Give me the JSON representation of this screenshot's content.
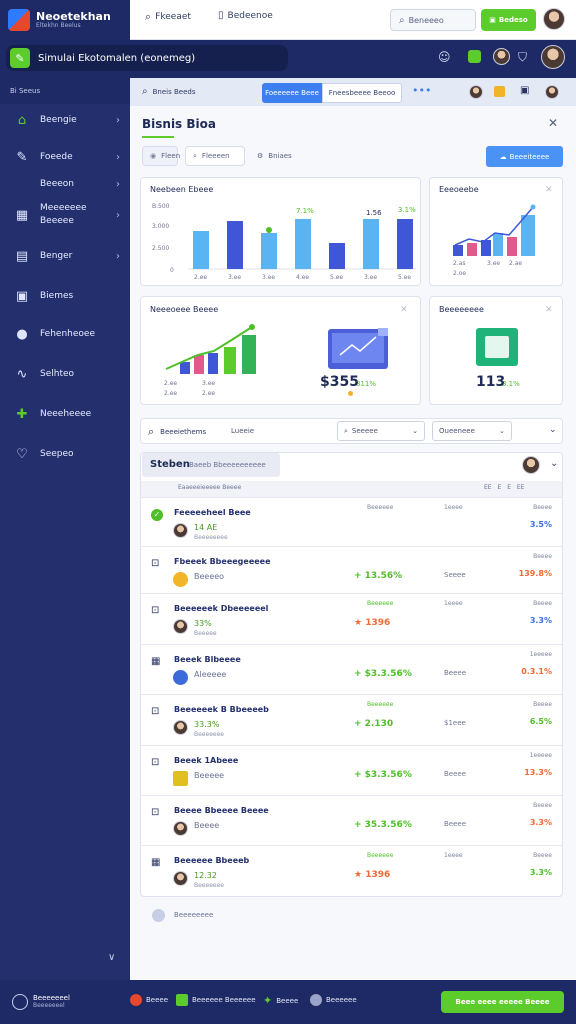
{
  "brand": {
    "title": "Neoetekhan",
    "subtitle": "Eltekhn Beelus"
  },
  "topnav": {
    "item1": "Fkeeaet",
    "item2": "Bedeenoe"
  },
  "search": {
    "placeholder": "Beneeeo"
  },
  "top_button": "Bedeso",
  "sim": {
    "label": "Simulai Ekotomalen (eonemeg)"
  },
  "sidebar": {
    "header": "Bi Seeus",
    "items": [
      {
        "label": "Beengie",
        "icon": "home-icon",
        "chevron": true
      },
      {
        "label": "Foeede",
        "icon": "pen-icon",
        "chevron": true
      },
      {
        "label": "Beeeon",
        "icon": "",
        "chevron": true
      },
      {
        "label": "Meeeeeee Beeeee",
        "icon": "grid-icon",
        "chevron": true
      },
      {
        "label": "Benger",
        "icon": "calendar-icon",
        "chevron": true
      },
      {
        "label": "Biemes",
        "icon": "briefcase-icon",
        "chevron": false
      },
      {
        "label": "Fehenheoee",
        "icon": "chat-icon",
        "chevron": false
      },
      {
        "label": "Selhteo",
        "icon": "pulse-icon",
        "chevron": false
      },
      {
        "label": "Neeeheeee",
        "icon": "puzzle-icon",
        "chevron": false
      },
      {
        "label": "Seepeo",
        "icon": "heart-icon",
        "chevron": false
      }
    ]
  },
  "filterbar": {
    "search": "Bneis Beeds",
    "tab_active": "Foeeeeee Beee",
    "tab_inactive": "Fneesbeeee Beeoo"
  },
  "panel": {
    "title": "Bisnis Bioa",
    "chips": [
      "Fleen",
      "Fleeeen",
      "Bniaes"
    ],
    "action": "Beeeiteeee"
  },
  "cards": {
    "card1": {
      "title": "Neebeen Ebeee",
      "yticks": [
        "B.500",
        "3.000",
        "2.500",
        "0"
      ],
      "xticks": [
        "2.ee",
        "3.ee",
        "3.ee",
        "4.ee",
        "5.ee",
        "3.ee",
        "5.ee"
      ],
      "annotations": [
        "7.1%",
        "1.56",
        "3.1%"
      ]
    },
    "card2": {
      "title": "Eeeoeebe",
      "xticks": [
        "2.as",
        "3.ee",
        "2.ae",
        "2.oe"
      ]
    },
    "card3": {
      "title": "Neeeoeee Beeee",
      "stat": "$355",
      "pct": "311%",
      "xticks": [
        "2.ee",
        "3.ee",
        "2.ee"
      ]
    },
    "card4": {
      "title": "Beeeeeeee",
      "stat": "113",
      "pct": "3.1%"
    }
  },
  "list_filter": {
    "label": "Beeeiethems",
    "input": "Lueeie",
    "select1": "Seeeee",
    "select2": "Oueeneee"
  },
  "list": {
    "section_title": "Steben",
    "section_sub": "Baeeb Bbeeeeeeeeee",
    "head": "Eaaeeeieeeee Beeee",
    "head_right": "EE  E  E  EE",
    "rows": [
      {
        "title": "Feeeeeheel Beee",
        "sub": "14 AE",
        "sub2": "Beeeeeeee",
        "c1": "",
        "c1top": "Beeeeee",
        "c2": "",
        "c2top": "1eeee",
        "c3": "3.5%",
        "c3top": "Beeee",
        "c1color": "#4fbf27",
        "c3color": "#3b6ee0",
        "avatar": "#d7a26b"
      },
      {
        "title": "Fbeeek Bbeeegeeeee",
        "sub": "Beeeeo",
        "sub2": "",
        "c1": "+ 13.56%",
        "c1top": "",
        "c2": "Seeee",
        "c2top": "",
        "c3": "139.8%",
        "c3top": "Beeee",
        "c1color": "#4fbf27",
        "c3color": "#ef6a35",
        "avatar": "#f2b52a"
      },
      {
        "title": "Beeeeeek Dbeeeeeel",
        "sub": "33%",
        "sub2": "Beeeee",
        "c1": "★ 1396",
        "c1top": "Beeeeee",
        "c2": "",
        "c2top": "1eeee",
        "c3": "3.3%",
        "c3top": "Beeee",
        "c1color": "#ef6a35",
        "c3color": "#3b6ee0",
        "avatar": "#c98e63"
      },
      {
        "title": "Beeek Blbeeee",
        "sub": "Aleeeee",
        "sub2": "",
        "c1": "+ $3.3.56%",
        "c1top": "",
        "c2": "Beeee",
        "c2top": "",
        "c3": "0.3.1%",
        "c3top": "1eeeee",
        "c1color": "#4fbf27",
        "c3color": "#ef6a35",
        "avatar": "#3c6ad8"
      },
      {
        "title": "Beeeeeek B Bbeeeeb",
        "sub": "33.3%",
        "sub2": "Beeeeeee",
        "c1": "+ 2.130",
        "c1top": "Beeeeee",
        "c2": "$1eee",
        "c2top": "",
        "c3": "6.5%",
        "c3top": "Beeee",
        "c1color": "#4fbf27",
        "c3color": "#4fbf27",
        "avatar": "#c98e63"
      },
      {
        "title": "Beeek 1Abeee",
        "sub": "Beeeee",
        "sub2": "",
        "c1": "+ $3.3.56%",
        "c1top": "",
        "c2": "Beeee",
        "c2top": "",
        "c3": "13.3%",
        "c3top": "1eeeee",
        "c1color": "#4fbf27",
        "c3color": "#ef6a35",
        "avatar": "#e0c020"
      },
      {
        "title": "Beeee Bbeeee Beeee",
        "sub": "Beeee",
        "sub2": "",
        "c1": "+ 35.3.56%",
        "c1top": "",
        "c2": "Beeee",
        "c2top": "",
        "c3": "3.3%",
        "c3top": "Beeee",
        "c1color": "#4fbf27",
        "c3color": "#ef6a35",
        "avatar": "#c98e63"
      },
      {
        "title": "Beeeeee Bbeeeb",
        "sub": "12.32",
        "sub2": "Beeeeeee",
        "c1": "★ 1396",
        "c1top": "Beeeeee",
        "c2": "",
        "c2top": "1eeee",
        "c3": "3.3%",
        "c3top": "Beeee",
        "c1color": "#ef6a35",
        "c3color": "#4fbf27",
        "avatar": "#c98e63"
      }
    ],
    "footer_label": "Beeeeeeee"
  },
  "footer": {
    "brand_title": "Beeeeeeel",
    "brand_sub": "Beeeeeeel",
    "items": [
      "Beeee",
      "Beeeeee Beeeeee",
      "Beeee",
      "Beeeeee"
    ],
    "cta": "Beee eeee eeeee Beeee"
  },
  "colors": {
    "primary": "#1e2a66",
    "accent_green": "#5ccc2c",
    "accent_blue": "#4b92f5"
  }
}
